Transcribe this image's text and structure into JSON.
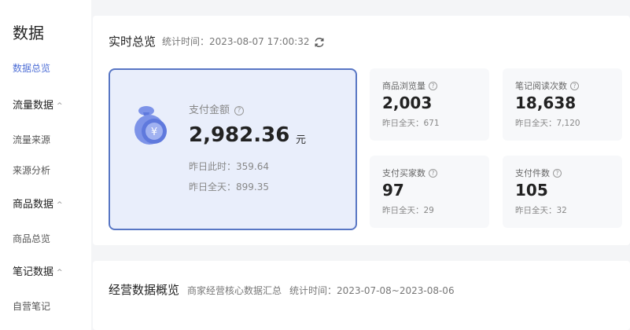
{
  "sidebar": {
    "title": "数据",
    "items": [
      {
        "label": "数据总览",
        "type": "item",
        "active": true
      },
      {
        "label": "流量数据",
        "type": "group"
      },
      {
        "label": "流量来源",
        "type": "item"
      },
      {
        "label": "来源分析",
        "type": "item"
      },
      {
        "label": "商品数据",
        "type": "group"
      },
      {
        "label": "商品总览",
        "type": "item"
      },
      {
        "label": "笔记数据",
        "type": "group"
      },
      {
        "label": "自营笔记",
        "type": "item"
      }
    ],
    "caret": "^"
  },
  "realtime": {
    "title": "实时总览",
    "time_label": "统计时间：",
    "time": "2023-08-07 17:00:32",
    "main": {
      "label": "支付金额",
      "value": "2,982.36",
      "unit": "元",
      "sub1": "昨日此时：359.64",
      "sub2": "昨日全天：899.35",
      "icon_glyph": "¥"
    },
    "metrics": [
      {
        "label": "商品浏览量",
        "value": "2,003",
        "sub": "昨日全天：671"
      },
      {
        "label": "笔记阅读次数",
        "value": "18,638",
        "sub": "昨日全天：7,120"
      },
      {
        "label": "支付买家数",
        "value": "97",
        "sub": "昨日全天：29"
      },
      {
        "label": "支付件数",
        "value": "105",
        "sub": "昨日全天：32"
      }
    ],
    "help_glyph": "?"
  },
  "operations": {
    "title": "经营数据概览",
    "desc": "商家经营核心数据汇总",
    "time_label": "统计时间：",
    "time": "2023-07-08~2023-08-06"
  },
  "colors": {
    "accent": "#4f6fd6",
    "main_card_bg": "#e9eefb",
    "main_card_border": "#5876c4"
  }
}
